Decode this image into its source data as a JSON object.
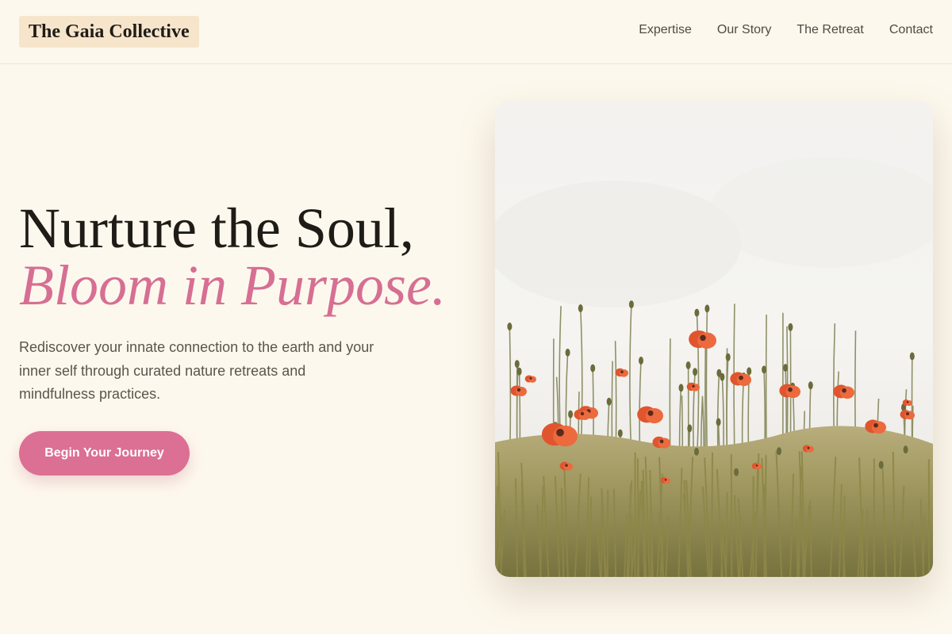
{
  "brand": {
    "name": "The Gaia Collective",
    "accent_color": "#dc6f94",
    "logo_bg": "#f6e5cb",
    "background": "#fdf8ed"
  },
  "nav": {
    "items": [
      {
        "label": "Expertise"
      },
      {
        "label": "Our Story"
      },
      {
        "label": "The Retreat"
      },
      {
        "label": "Contact"
      }
    ]
  },
  "hero": {
    "headline_line1": "Nurture the Soul,",
    "headline_line2": "Bloom in Purpose.",
    "description": "Rediscover your innate connection to the earth and your inner self through curated nature retreats and mindfulness practices.",
    "cta_label": "Begin Your Journey",
    "image": {
      "subject": "field of red poppies and wheat grass under a pale sky",
      "icon": "photo"
    }
  }
}
